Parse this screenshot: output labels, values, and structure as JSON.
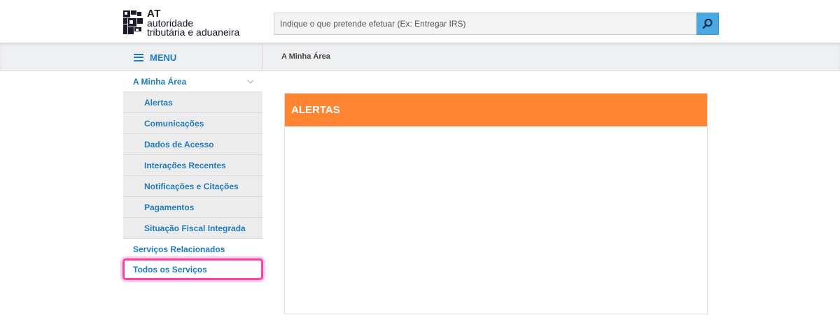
{
  "header": {
    "logo": {
      "line_at": "AT",
      "line1": "autoridade",
      "line2": "tributária e aduaneira"
    },
    "search": {
      "placeholder": "Indique o que pretende efetuar (Ex: Entregar IRS)",
      "value": ""
    }
  },
  "nav": {
    "menu_label": "MENU",
    "breadcrumb": "A Minha Área"
  },
  "sidebar": {
    "parent": {
      "label": "A Minha Área"
    },
    "items": [
      {
        "label": "Alertas"
      },
      {
        "label": "Comunicações"
      },
      {
        "label": "Dados de Acesso"
      },
      {
        "label": "Interações Recentes"
      },
      {
        "label": "Notificações e Citações"
      },
      {
        "label": "Pagamentos"
      },
      {
        "label": "Situação Fiscal Integrada"
      }
    ],
    "related": {
      "label": "Serviços Relacionados"
    },
    "all_services": {
      "label": "Todos os Serviços"
    }
  },
  "main": {
    "panel_title": "ALERTAS"
  },
  "colors": {
    "accent_blue": "#1f7bbf",
    "search_button": "#4aa8e3",
    "panel_header": "#ff8533",
    "highlight": "#ff3fa4"
  }
}
